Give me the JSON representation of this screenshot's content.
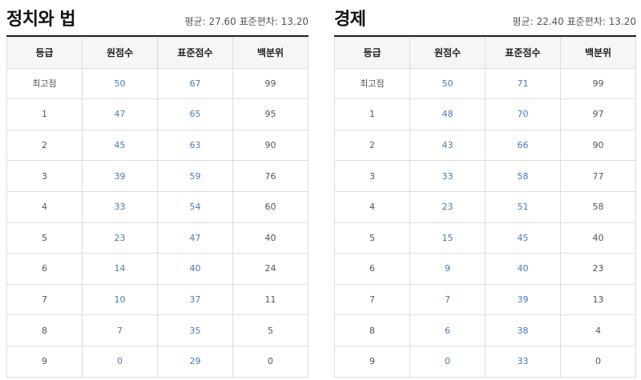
{
  "panels": [
    {
      "title": "정치와 법",
      "stats": "평균: 27.60 표준편차: 13.20",
      "columns": [
        "등급",
        "원점수",
        "표준점수",
        "백분위"
      ],
      "rows": [
        [
          "최고점",
          "50",
          "67",
          "99"
        ],
        [
          "1",
          "47",
          "65",
          "95"
        ],
        [
          "2",
          "45",
          "63",
          "90"
        ],
        [
          "3",
          "39",
          "59",
          "76"
        ],
        [
          "4",
          "33",
          "54",
          "60"
        ],
        [
          "5",
          "23",
          "47",
          "40"
        ],
        [
          "6",
          "14",
          "40",
          "24"
        ],
        [
          "7",
          "10",
          "37",
          "11"
        ],
        [
          "8",
          "7",
          "35",
          "5"
        ],
        [
          "9",
          "0",
          "29",
          "0"
        ]
      ]
    },
    {
      "title": "경제",
      "stats": "평균: 22.40 표준편차: 13.20",
      "columns": [
        "등급",
        "원점수",
        "표준점수",
        "백분위"
      ],
      "rows": [
        [
          "최고점",
          "50",
          "71",
          "99"
        ],
        [
          "1",
          "48",
          "70",
          "97"
        ],
        [
          "2",
          "43",
          "66",
          "90"
        ],
        [
          "3",
          "33",
          "58",
          "77"
        ],
        [
          "4",
          "23",
          "51",
          "58"
        ],
        [
          "5",
          "15",
          "45",
          "40"
        ],
        [
          "6",
          "9",
          "40",
          "23"
        ],
        [
          "7",
          "7",
          "39",
          "13"
        ],
        [
          "8",
          "6",
          "38",
          "4"
        ],
        [
          "9",
          "0",
          "33",
          "0"
        ]
      ]
    }
  ]
}
